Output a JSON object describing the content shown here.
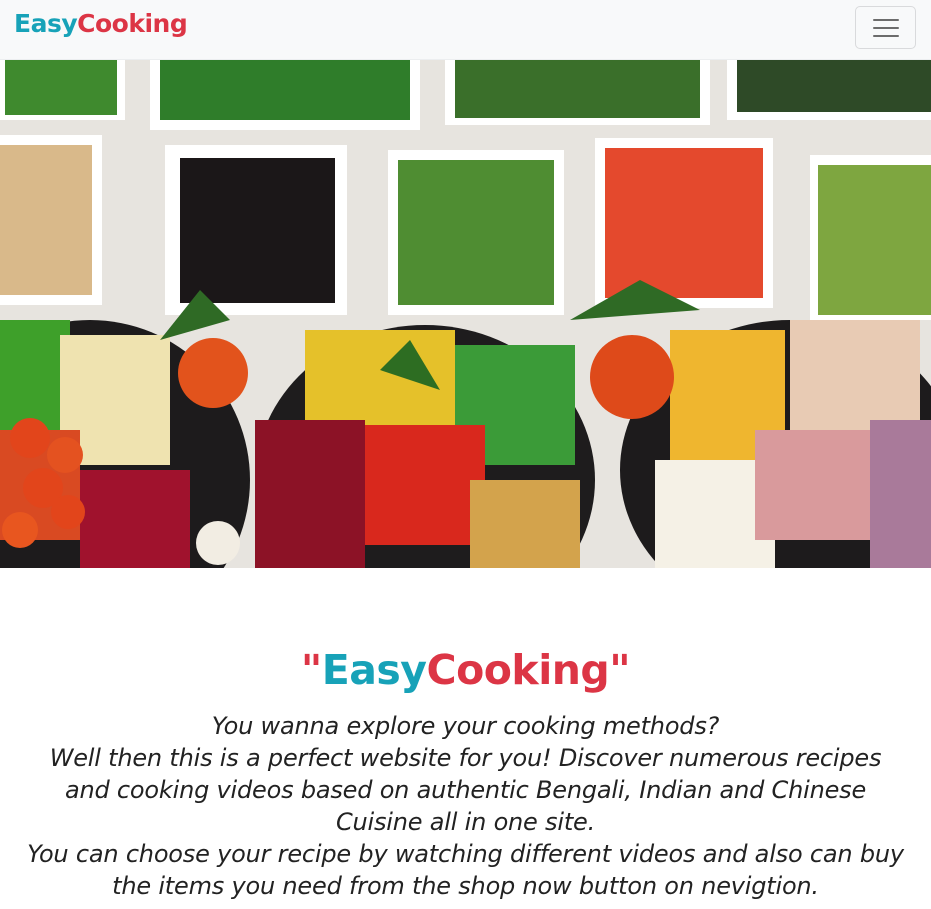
{
  "navbar": {
    "brand_part1": "Easy",
    "brand_part2": "Cooking",
    "toggle_icon": "hamburger-menu-icon"
  },
  "hero": {
    "image_alt": "Colorful salad bar with bowls of fresh vegetables"
  },
  "intro": {
    "quote_open": "\"",
    "title_part1": "Easy",
    "title_part2": "Cooking",
    "quote_close": "\"",
    "line1": "You wanna explore your cooking methods?",
    "line2": "Well then this is a perfect website for you! Discover numerous recipes and cooking videos based on authentic Bengali, Indian and Chinese Cuisine all in one site.",
    "line3": "You can choose your recipe by watching different videos and also can buy the items you need from the shop now button on nevigtion."
  },
  "colors": {
    "brand_teal": "#17a2b8",
    "brand_red": "#dc3545",
    "navbar_bg": "#f8f9fa"
  }
}
